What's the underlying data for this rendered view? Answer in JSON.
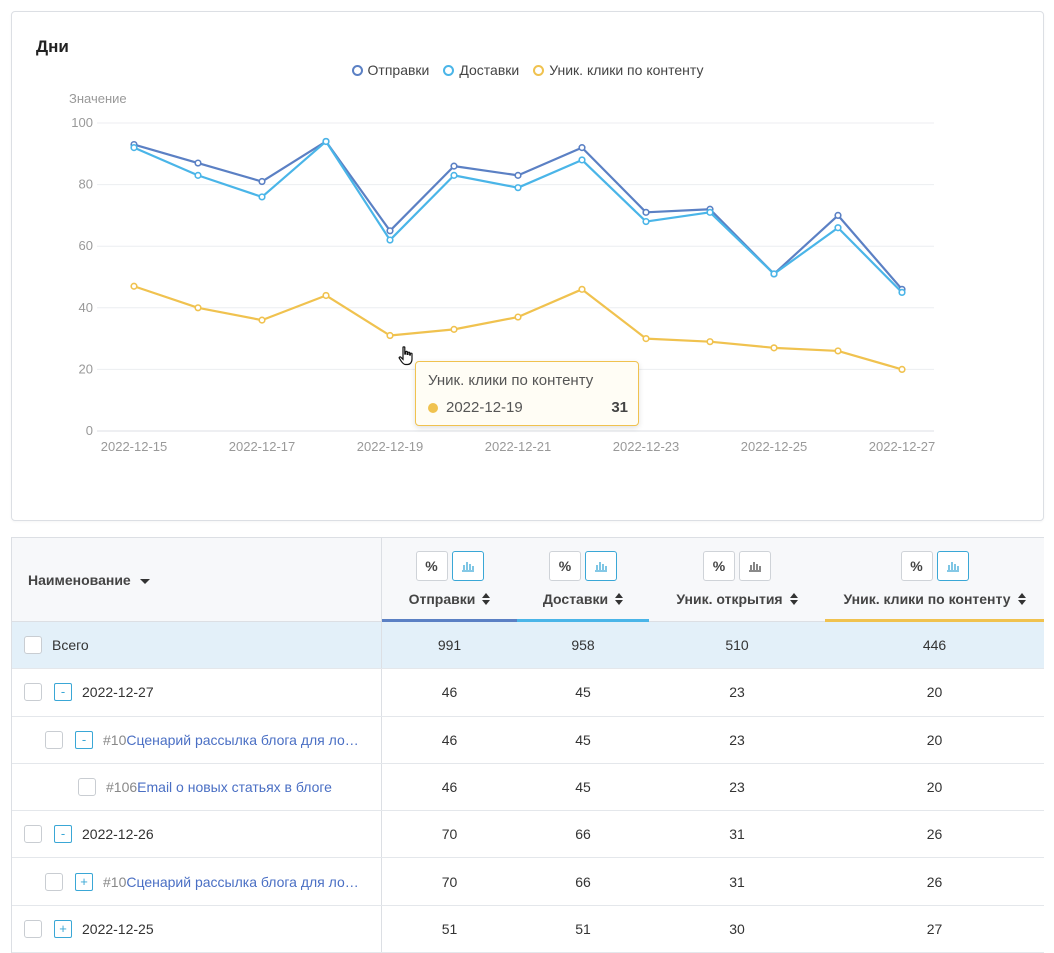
{
  "chart": {
    "title": "Дни",
    "ylabel": "Значение",
    "legend": [
      {
        "label": "Отправки",
        "color": "#5b80c4"
      },
      {
        "label": "Доставки",
        "color": "#4ab5e8"
      },
      {
        "label": "Уник. клики по контенту",
        "color": "#f0c24f"
      }
    ],
    "tooltip": {
      "title": "Уник. клики по контенту",
      "date": "2022-12-19",
      "value": "31"
    }
  },
  "chart_data": {
    "type": "line",
    "title": "Дни",
    "xlabel": "",
    "ylabel": "Значение",
    "ylim": [
      0,
      100
    ],
    "yticks": [
      "0",
      "20",
      "40",
      "60",
      "80",
      "100"
    ],
    "xtick_labels": [
      "2022-12-15",
      "2022-12-17",
      "2022-12-19",
      "2022-12-21",
      "2022-12-23",
      "2022-12-25",
      "2022-12-27"
    ],
    "x": [
      "2022-12-15",
      "2022-12-16",
      "2022-12-17",
      "2022-12-18",
      "2022-12-19",
      "2022-12-20",
      "2022-12-21",
      "2022-12-22",
      "2022-12-23",
      "2022-12-24",
      "2022-12-25",
      "2022-12-26",
      "2022-12-27"
    ],
    "series": [
      {
        "name": "Отправки",
        "color": "#5b80c4",
        "values": [
          93,
          87,
          81,
          94,
          65,
          86,
          83,
          92,
          71,
          72,
          51,
          70,
          46
        ]
      },
      {
        "name": "Доставки",
        "color": "#4ab5e8",
        "values": [
          92,
          83,
          76,
          94,
          62,
          83,
          79,
          88,
          68,
          71,
          51,
          66,
          45
        ]
      },
      {
        "name": "Уник. клики по контенту",
        "color": "#f0c24f",
        "values": [
          47,
          40,
          36,
          44,
          31,
          33,
          37,
          46,
          30,
          29,
          27,
          26,
          20
        ]
      }
    ],
    "grid": true,
    "legend_position": "top-center"
  },
  "table": {
    "header": {
      "name": "Наименование",
      "columns": [
        {
          "label": "Отправки",
          "btn_pct": "%",
          "color": "#5b80c4",
          "chart_active": true
        },
        {
          "label": "Доставки",
          "btn_pct": "%",
          "color": "#4ab5e8",
          "chart_active": true
        },
        {
          "label": "Уник. открытия",
          "btn_pct": "%",
          "color": "",
          "chart_active": false
        },
        {
          "label": "Уник. клики по контенту",
          "btn_pct": "%",
          "color": "#f0c24f",
          "chart_active": true
        }
      ]
    },
    "rows": [
      {
        "kind": "total",
        "level": 0,
        "toggle": "",
        "id": "",
        "name": "Всего",
        "link": false,
        "values": [
          "991",
          "958",
          "510",
          "446"
        ]
      },
      {
        "kind": "date",
        "level": 0,
        "toggle": "-",
        "id": "",
        "name": "2022-12-27",
        "link": false,
        "values": [
          "46",
          "45",
          "23",
          "20"
        ]
      },
      {
        "kind": "scenario",
        "level": 1,
        "toggle": "-",
        "id": "#10",
        "name": "Сценарий рассылка блога для ло…",
        "link": true,
        "values": [
          "46",
          "45",
          "23",
          "20"
        ]
      },
      {
        "kind": "email",
        "level": 2,
        "toggle": "",
        "id": "#106",
        "name": "Email о новых статьях в блоге",
        "link": true,
        "values": [
          "46",
          "45",
          "23",
          "20"
        ]
      },
      {
        "kind": "date",
        "level": 0,
        "toggle": "-",
        "id": "",
        "name": "2022-12-26",
        "link": false,
        "values": [
          "70",
          "66",
          "31",
          "26"
        ]
      },
      {
        "kind": "scenario",
        "level": 1,
        "toggle": "+",
        "id": "#10",
        "name": "Сценарий рассылка блога для ло…",
        "link": true,
        "values": [
          "70",
          "66",
          "31",
          "26"
        ]
      },
      {
        "kind": "date",
        "level": 0,
        "toggle": "+",
        "id": "",
        "name": "2022-12-25",
        "link": false,
        "values": [
          "51",
          "51",
          "30",
          "27"
        ]
      }
    ]
  }
}
